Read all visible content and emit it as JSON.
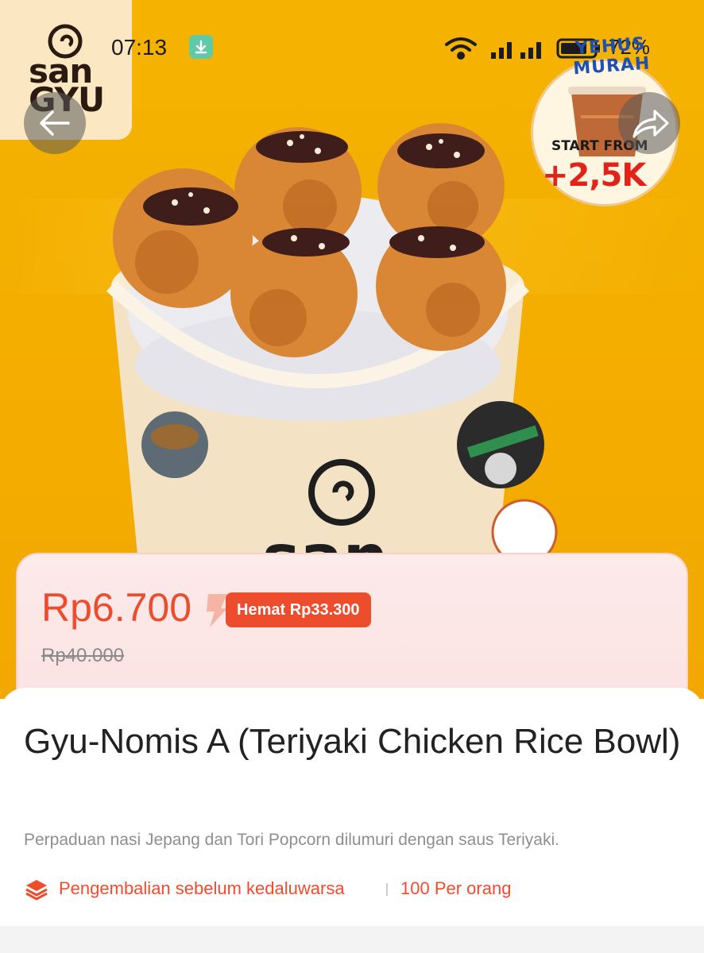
{
  "status_bar": {
    "time": "07:13",
    "battery": "72%",
    "icons": [
      "download-icon",
      "wifi-icon",
      "signal-icon",
      "signal-icon",
      "battery-icon"
    ]
  },
  "brand": {
    "logo_text": "san GYU"
  },
  "promo": {
    "headline": "YEHUS MURAH",
    "start_label": "START FROM",
    "price": "+2,5K"
  },
  "nav": {
    "back_icon": "back-arrow-icon",
    "share_icon": "share-icon"
  },
  "price": {
    "current": "Rp6.700",
    "saving": "Hemat Rp33.300",
    "original": "Rp40.000"
  },
  "product": {
    "title": "Gyu-Nomis A (Teriyaki Chicken Rice Bowl)",
    "description": "Perpaduan nasi Jepang dan Tori Popcorn dilumuri dengan saus Teriyaki.",
    "features": [
      {
        "label": "Pengembalian sebelum kedaluwarsa",
        "icon": "layers-icon"
      },
      {
        "label": "100 Per orang"
      }
    ]
  },
  "colors": {
    "accent": "#ee4d2d",
    "hero_bg": "#f5b300",
    "price_card_bg": "#fdeaea"
  }
}
